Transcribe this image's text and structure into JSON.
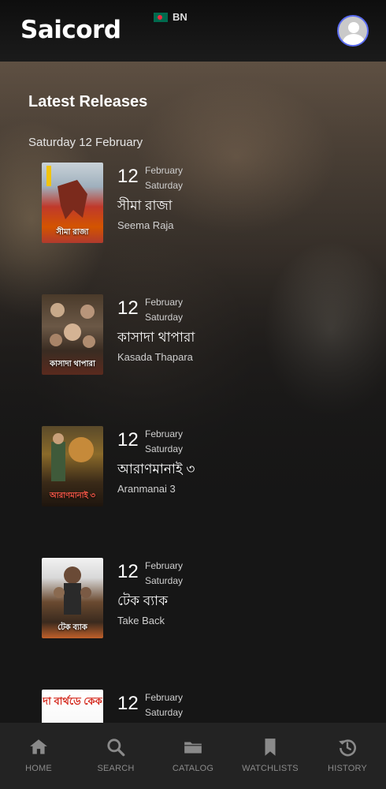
{
  "header": {
    "logo": "Saicord",
    "language": "BN"
  },
  "section": {
    "title": "Latest Releases",
    "date_heading": "Saturday 12 February"
  },
  "releases": [
    {
      "day": "12",
      "month": "February",
      "weekday": "Saturday",
      "title_bn": "সীমা রাজা",
      "title_en": "Seema Raja",
      "poster_text": "সীমা রাজা"
    },
    {
      "day": "12",
      "month": "February",
      "weekday": "Saturday",
      "title_bn": "কাসাদা থাপারা",
      "title_en": "Kasada Thapara",
      "poster_text": "কাসাদা থাপারা"
    },
    {
      "day": "12",
      "month": "February",
      "weekday": "Saturday",
      "title_bn": "আরাণমানাই ৩",
      "title_en": "Aranmanai 3",
      "poster_text": "আরাণমানাই ৩"
    },
    {
      "day": "12",
      "month": "February",
      "weekday": "Saturday",
      "title_bn": "টেক ব্যাক",
      "title_en": "Take Back",
      "poster_text": "টেক ব্যাক"
    },
    {
      "day": "12",
      "month": "February",
      "weekday": "Saturday",
      "poster_text": "দা বার্থডে কেক"
    }
  ],
  "nav": [
    {
      "label": "HOME",
      "icon": "home-icon"
    },
    {
      "label": "SEARCH",
      "icon": "search-icon"
    },
    {
      "label": "CATALOG",
      "icon": "folder-icon"
    },
    {
      "label": "WATCHLISTS",
      "icon": "bookmark-icon"
    },
    {
      "label": "HISTORY",
      "icon": "history-icon"
    }
  ],
  "colors": {
    "background": "#161616",
    "header": "#1b1b1b",
    "nav_bar": "#232323",
    "nav_label": "#8a8a8a",
    "avatar_ring": "#5b6cf0"
  }
}
